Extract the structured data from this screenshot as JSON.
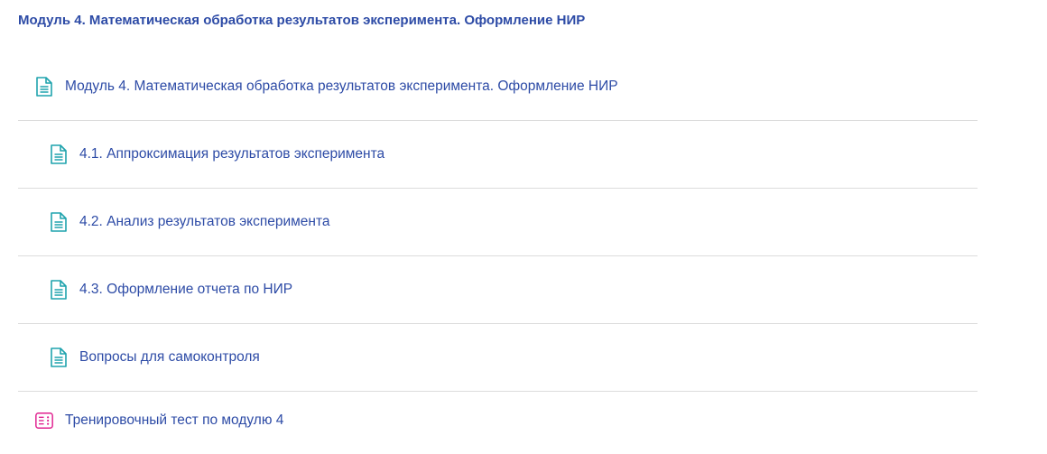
{
  "section": {
    "title": "Модуль 4. Математическая обработка результатов эксперимента. Оформление НИР"
  },
  "colors": {
    "link": "#2d4ba6",
    "page_icon": "#1fa3ad",
    "quiz_icon": "#e0208f",
    "divider": "#dcdcdc"
  },
  "activities": [
    {
      "label": "Модуль 4. Математическая обработка результатов эксперимента. Оформление НИР",
      "icon": "page-icon"
    },
    {
      "label": "4.1. Аппроксимация результатов эксперимента",
      "icon": "page-icon"
    },
    {
      "label": "4.2. Анализ результатов эксперимента",
      "icon": "page-icon"
    },
    {
      "label": "4.3. Оформление отчета по НИР",
      "icon": "page-icon"
    },
    {
      "label": "Вопросы для самоконтроля",
      "icon": "page-icon"
    },
    {
      "label": "Тренировочный тест по модулю 4",
      "icon": "quiz-icon"
    }
  ]
}
